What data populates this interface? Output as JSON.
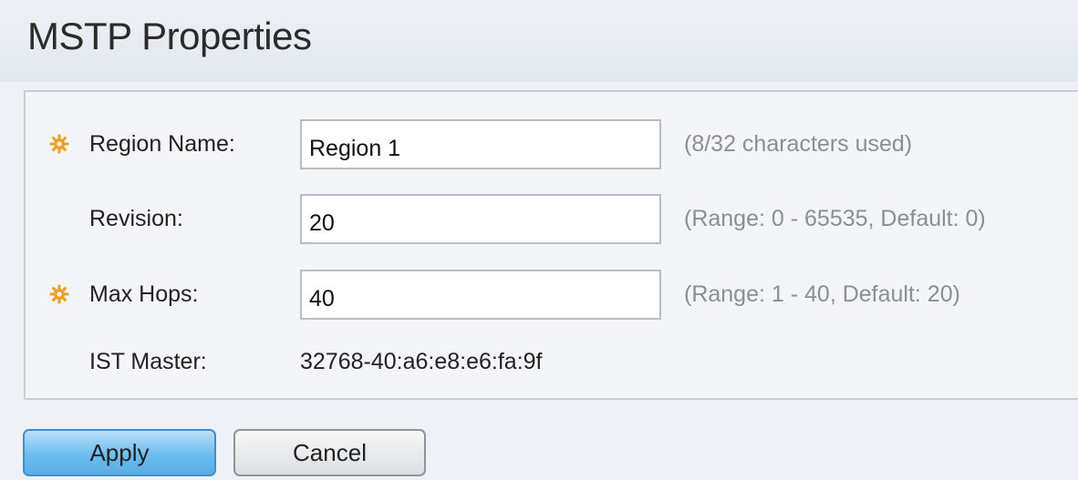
{
  "page": {
    "title": "MSTP Properties"
  },
  "form": {
    "region_name": {
      "label": "Region Name:",
      "value": "Region 1",
      "hint": "(8/32 characters used)",
      "required": true
    },
    "revision": {
      "label": "Revision:",
      "value": "20",
      "hint": "(Range: 0 - 65535, Default: 0)",
      "required": false
    },
    "max_hops": {
      "label": "Max Hops:",
      "value": "40",
      "hint": "(Range: 1 - 40, Default: 20)",
      "required": true
    },
    "ist_master": {
      "label": "IST Master:",
      "value": "32768-40:a6:e8:e6:fa:9f"
    }
  },
  "buttons": {
    "apply_label": "Apply",
    "cancel_label": "Cancel"
  },
  "icons": {
    "required": "required-field-gear-icon"
  },
  "colors": {
    "required_icon": "#f0a020",
    "hint_text": "#8a8f96",
    "apply_button": "#6cbcee",
    "panel_border": "#c9ced6"
  }
}
